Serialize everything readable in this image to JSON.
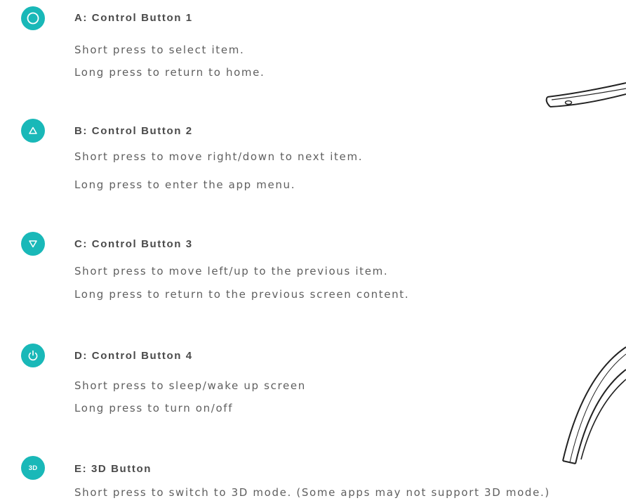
{
  "accent_color": "#19b8b8",
  "buttons": [
    {
      "icon": "circle-icon",
      "title": "A: Control Button 1",
      "lines": [
        "Short press to select item.",
        "Long press to return to home."
      ]
    },
    {
      "icon": "triangle-up-icon",
      "title": "B: Control Button 2",
      "lines": [
        "Short press to move right/down to next item.",
        "Long press to enter the app menu."
      ]
    },
    {
      "icon": "triangle-down-icon",
      "title": "C: Control Button 3",
      "lines": [
        "Short press to move left/up to the previous item.",
        "Long press to return to the previous screen content."
      ]
    },
    {
      "icon": "power-icon",
      "title": "D: Control Button 4",
      "lines": [
        "Short press to sleep/wake up screen",
        "Long press to turn on/off"
      ]
    },
    {
      "icon": "3d-badge",
      "badge_text": "3D",
      "title": "E: 3D Button",
      "lines": [
        "Short press to switch to 3D mode. (Some apps may not support 3D mode.)"
      ]
    }
  ]
}
